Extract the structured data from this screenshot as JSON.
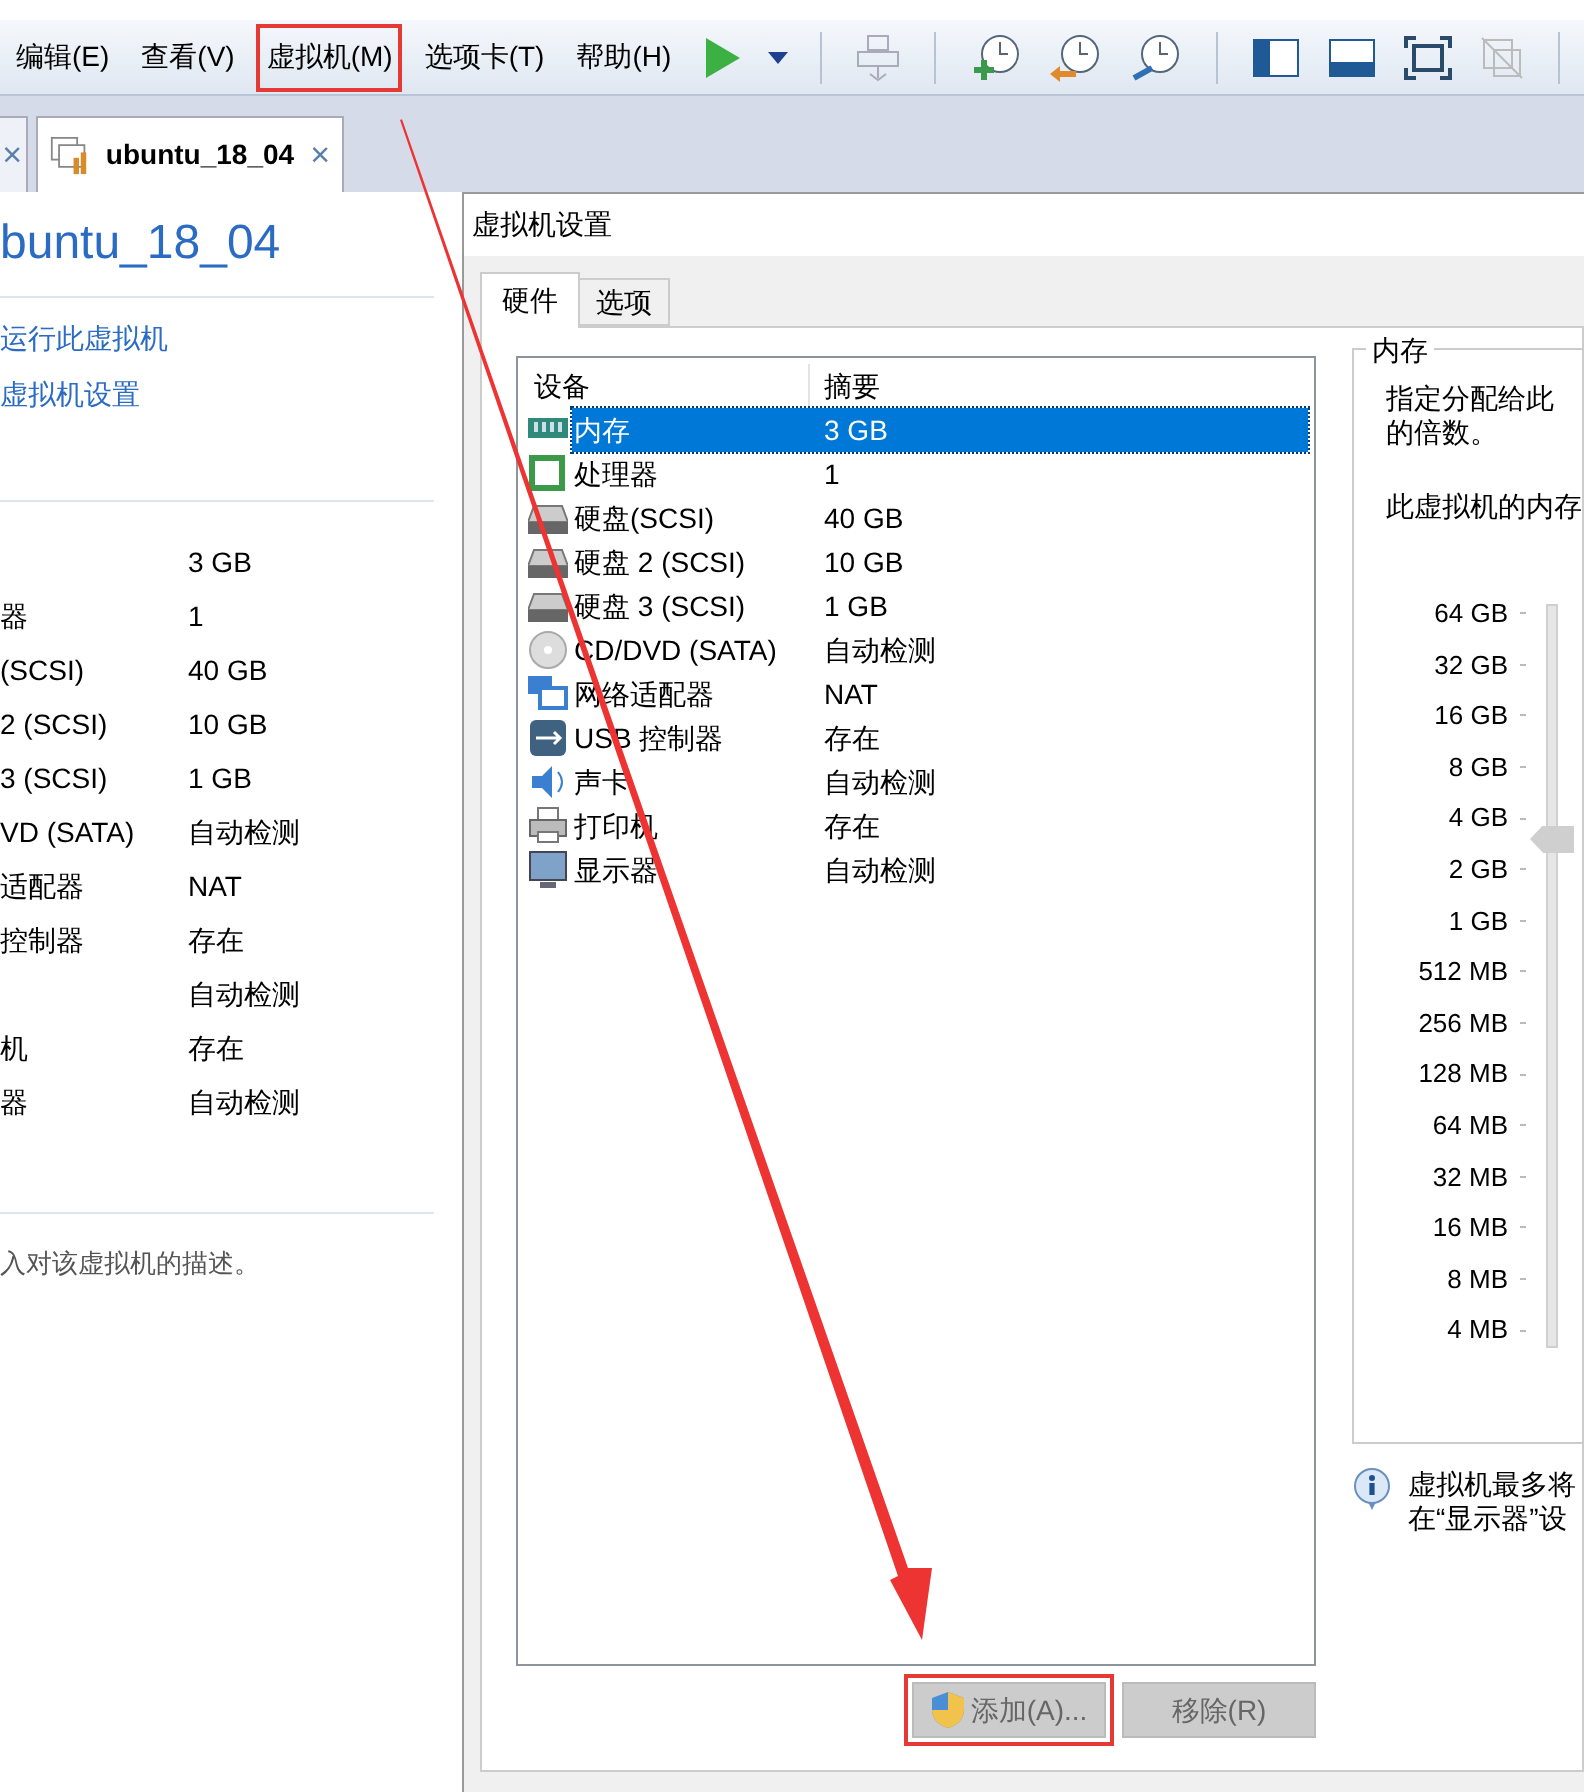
{
  "menu": [
    {
      "label": "编辑(E)",
      "highlighted": false
    },
    {
      "label": "查看(V)",
      "highlighted": false
    },
    {
      "label": "虚拟机(M)",
      "highlighted": true
    },
    {
      "label": "选项卡(T)",
      "highlighted": false
    },
    {
      "label": "帮助(H)",
      "highlighted": false
    }
  ],
  "toolbar": [
    {
      "kind": "play"
    },
    {
      "kind": "caret"
    },
    {
      "kind": "sep"
    },
    {
      "kind": "network"
    },
    {
      "kind": "sep"
    },
    {
      "kind": "snap-take"
    },
    {
      "kind": "snap-revert"
    },
    {
      "kind": "snap-manage"
    },
    {
      "kind": "sep"
    },
    {
      "kind": "view-sidebar"
    },
    {
      "kind": "view-thumb"
    },
    {
      "kind": "view-full"
    },
    {
      "kind": "view-unity"
    },
    {
      "kind": "sep"
    }
  ],
  "tabs": [
    {
      "close": "×",
      "selected": false
    },
    {
      "label": "ubuntu_18_04",
      "close": "×",
      "selected": true
    }
  ],
  "vm_panel": {
    "title": "buntu_18_04",
    "actions": [
      "运行此虚拟机",
      "虚拟机设置"
    ],
    "devices": [
      {
        "value": "3 GB"
      },
      {
        "name": "器",
        "value": "1"
      },
      {
        "name": "(SCSI)",
        "value": "40 GB"
      },
      {
        "name": "2 (SCSI)",
        "value": "10 GB"
      },
      {
        "name": "3 (SCSI)",
        "value": "1 GB"
      },
      {
        "name": "VD (SATA)",
        "value": "自动检测"
      },
      {
        "name": "适配器",
        "value": "NAT"
      },
      {
        "name": "控制器",
        "value": "存在"
      },
      {
        "value": "自动检测"
      },
      {
        "name": "机",
        "value": "存在"
      },
      {
        "name": "器",
        "value": "自动检测"
      }
    ],
    "description": "入对该虚拟机的描述。"
  },
  "dialog": {
    "title": "虚拟机设置",
    "tabs": [
      {
        "label": "硬件",
        "selected": true
      },
      {
        "label": "选项",
        "selected": false
      }
    ],
    "columns": [
      "设备",
      "摘要"
    ],
    "rows": [
      {
        "kind": "memory",
        "device": "内存",
        "summary": "3 GB",
        "selected": true
      },
      {
        "kind": "cpu",
        "device": "处理器",
        "summary": "1",
        "selected": false
      },
      {
        "kind": "disk",
        "device": "硬盘(SCSI)",
        "summary": "40 GB",
        "selected": false
      },
      {
        "kind": "disk",
        "device": "硬盘 2 (SCSI)",
        "summary": "10 GB",
        "selected": false
      },
      {
        "kind": "disk",
        "device": "硬盘 3 (SCSI)",
        "summary": "1 GB",
        "selected": false
      },
      {
        "kind": "cd",
        "device": "CD/DVD (SATA)",
        "summary": "自动检测",
        "selected": false
      },
      {
        "kind": "network",
        "device": "网络适配器",
        "summary": "NAT",
        "selected": false
      },
      {
        "kind": "usb",
        "device": "USB 控制器",
        "summary": "存在",
        "selected": false
      },
      {
        "kind": "sound",
        "device": "声卡",
        "summary": "自动检测",
        "selected": false
      },
      {
        "kind": "printer",
        "device": "打印机",
        "summary": "存在",
        "selected": false
      },
      {
        "kind": "display",
        "device": "显示器",
        "summary": "自动检测",
        "selected": false
      }
    ],
    "buttons": [
      {
        "label": "添加(A)...",
        "shield": true,
        "highlighted": true
      },
      {
        "label": "移除(R)",
        "shield": false,
        "highlighted": false
      }
    ],
    "memory": {
      "group": "内存",
      "desc_lines": [
        "指定分配给此",
        "的倍数。"
      ],
      "prompt": "此虚拟机的内存",
      "scale": [
        "64 GB",
        "32 GB",
        "16 GB",
        "8 GB",
        "4 GB",
        "2 GB",
        "1 GB",
        "512 MB",
        "256 MB",
        "128 MB",
        "64 MB",
        "32 MB",
        "16 MB",
        "8 MB",
        "4 MB"
      ],
      "level": 0.684,
      "note_lines": [
        "虚拟机最多将",
        "在“显示器”设"
      ]
    }
  }
}
